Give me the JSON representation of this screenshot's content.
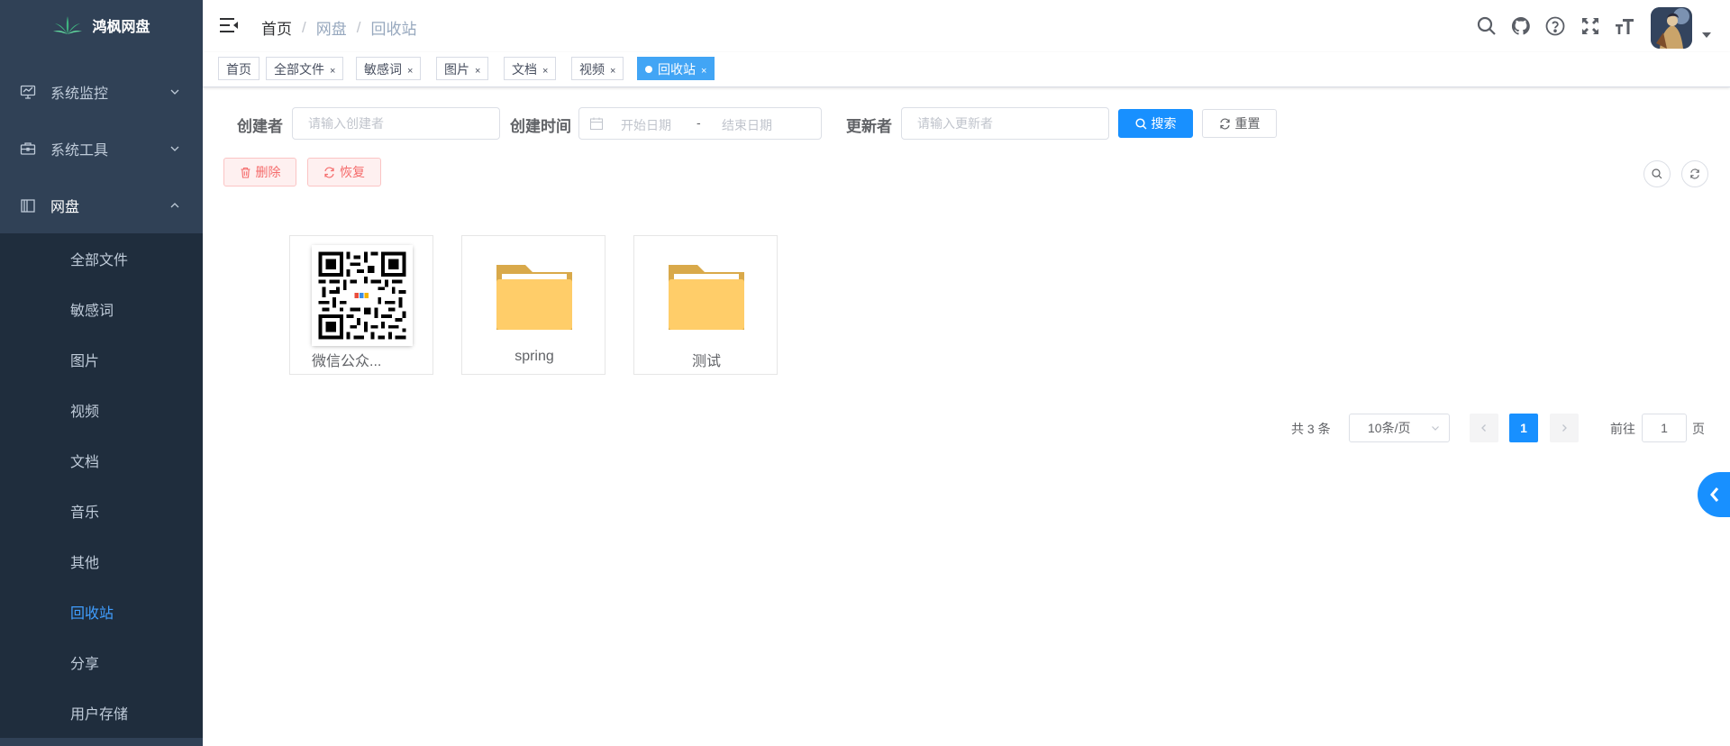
{
  "app": {
    "title": "鸿枫网盘"
  },
  "sidebar": {
    "menus": [
      {
        "label": "系统监控",
        "icon": "monitor-icon",
        "open": false
      },
      {
        "label": "系统工具",
        "icon": "toolbox-icon",
        "open": false
      },
      {
        "label": "网盘",
        "icon": "book-icon",
        "open": true
      }
    ],
    "sub_items": [
      {
        "label": "全部文件"
      },
      {
        "label": "敏感词"
      },
      {
        "label": "图片"
      },
      {
        "label": "视频"
      },
      {
        "label": "文档"
      },
      {
        "label": "音乐"
      },
      {
        "label": "其他"
      },
      {
        "label": "回收站",
        "active": true
      },
      {
        "label": "分享"
      },
      {
        "label": "用户存储"
      }
    ]
  },
  "header": {
    "breadcrumb": [
      "首页",
      "网盘",
      "回收站"
    ],
    "icons": [
      "search-icon",
      "github-icon",
      "help-icon",
      "fullscreen-icon",
      "font-size-icon"
    ]
  },
  "tags": [
    {
      "label": "首页",
      "closable": false
    },
    {
      "label": "全部文件",
      "closable": true
    },
    {
      "label": "敏感词",
      "closable": true
    },
    {
      "label": "图片",
      "closable": true
    },
    {
      "label": "文档",
      "closable": true
    },
    {
      "label": "视频",
      "closable": true
    },
    {
      "label": "回收站",
      "closable": true,
      "active": true
    }
  ],
  "tag_close": "×",
  "search": {
    "creator_label": "创建者",
    "creator_placeholder": "请输入创建者",
    "time_label": "创建时间",
    "start_placeholder": "开始日期",
    "range_sep": "-",
    "end_placeholder": "结束日期",
    "updater_label": "更新者",
    "updater_placeholder": "请输入更新者",
    "search_btn": "搜索",
    "reset_btn": "重置"
  },
  "toolbar": {
    "delete_btn": "删除",
    "restore_btn": "恢复"
  },
  "files": [
    {
      "name": "微信公众...",
      "type": "image-qr"
    },
    {
      "name": "spring",
      "type": "folder"
    },
    {
      "name": "测试",
      "type": "folder"
    }
  ],
  "pagination": {
    "total_text": "共 3 条",
    "page_size": "10条/页",
    "current_page": "1",
    "goto_label": "前往",
    "goto_value": "1",
    "page_unit": "页"
  },
  "colors": {
    "primary": "#1890ff",
    "sidebar": "#304156",
    "submenu": "#1f2d3d",
    "folder": "#ffcd69"
  }
}
